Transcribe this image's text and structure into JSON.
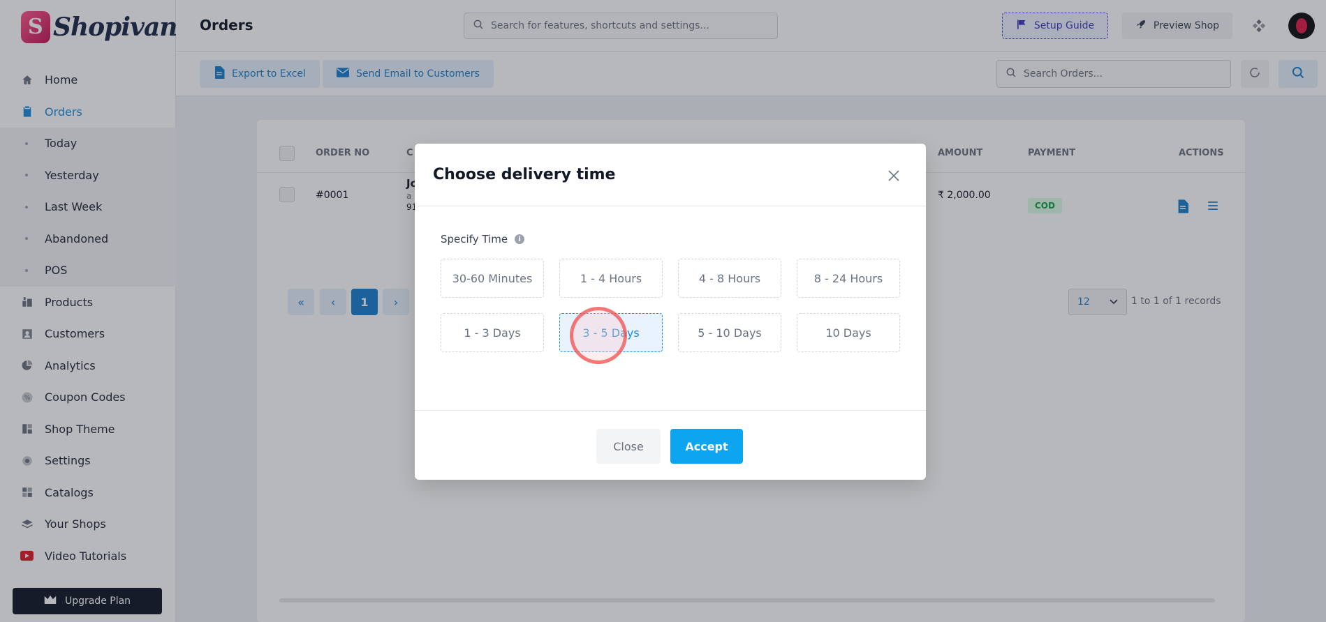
{
  "brand": {
    "name": "Shopivana"
  },
  "sidebar": {
    "items": [
      {
        "label": "Home",
        "icon": "home-icon"
      },
      {
        "label": "Orders",
        "icon": "clipboard-icon",
        "active": true
      },
      {
        "label": "Today"
      },
      {
        "label": "Yesterday"
      },
      {
        "label": "Last Week"
      },
      {
        "label": "Abandoned"
      },
      {
        "label": "POS"
      },
      {
        "label": "Products",
        "icon": "products-icon"
      },
      {
        "label": "Customers",
        "icon": "customer-icon"
      },
      {
        "label": "Analytics",
        "icon": "pie-chart-icon"
      },
      {
        "label": "Coupon Codes",
        "icon": "percent-icon"
      },
      {
        "label": "Shop Theme",
        "icon": "layout-icon"
      },
      {
        "label": "Settings",
        "icon": "gear-icon"
      },
      {
        "label": "Catalogs",
        "icon": "grid-icon"
      },
      {
        "label": "Your Shops",
        "icon": "layers-icon"
      },
      {
        "label": "Video Tutorials",
        "icon": "youtube-icon"
      }
    ],
    "upgrade_label": "Upgrade Plan"
  },
  "header": {
    "title": "Orders",
    "search_placeholder": "Search for features, shortcuts and settings...",
    "setup_guide": "Setup Guide",
    "preview_shop": "Preview Shop"
  },
  "toolbar": {
    "export_label": "Export to Excel",
    "email_label": "Send Email to Customers",
    "search_placeholder": "Search Orders..."
  },
  "table": {
    "columns": {
      "order_no": "ORDER NO",
      "customer": "C",
      "amount": "AMOUNT",
      "payment": "PAYMENT",
      "actions": "ACTIONS"
    },
    "rows": [
      {
        "order_no": "#0001",
        "customer_initial": "Jo",
        "customer_line2": "a",
        "customer_line3": "91",
        "amount": "₹ 2,000.00",
        "payment": "COD"
      }
    ]
  },
  "pagination": {
    "current": "1",
    "per_page": "12",
    "records": "1 to 1 of 1 records"
  },
  "modal": {
    "title": "Choose delivery time",
    "specify_label": "Specify Time",
    "options": [
      "30-60 Minutes",
      "1 - 4 Hours",
      "4 - 8 Hours",
      "8 - 24 Hours",
      "1 - 3 Days",
      "3 - 5 Days",
      "5 - 10 Days",
      "10 Days"
    ],
    "selected_option": "3 - 5 Days",
    "close_label": "Close",
    "accept_label": "Accept"
  },
  "colors": {
    "accent": "#1a8ce0",
    "accept": "#0ea5f0",
    "cod_green": "#16a34a",
    "setup_border": "#4f46e5"
  }
}
